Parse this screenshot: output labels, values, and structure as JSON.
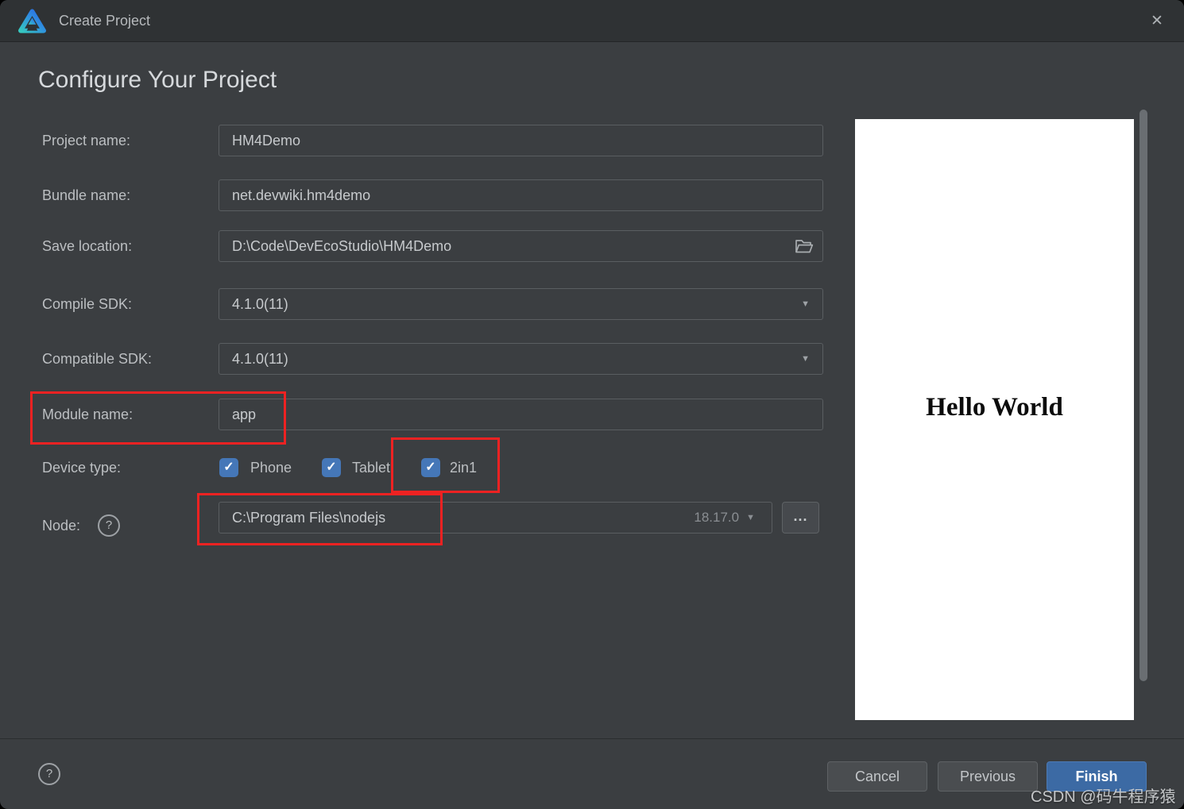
{
  "window": {
    "title": "Create Project",
    "close": "✕"
  },
  "heading": "Configure Your Project",
  "form": {
    "project_name": {
      "label": "Project name:",
      "value": "HM4Demo"
    },
    "bundle_name": {
      "label": "Bundle name:",
      "value": "net.devwiki.hm4demo"
    },
    "save_location": {
      "label": "Save location:",
      "value": "D:\\Code\\DevEcoStudio\\HM4Demo"
    },
    "compile_sdk": {
      "label": "Compile SDK:",
      "value": "4.1.0(11)"
    },
    "compatible_sdk": {
      "label": "Compatible SDK:",
      "value": "4.1.0(11)"
    },
    "module_name": {
      "label": "Module name:",
      "value": "app"
    },
    "device_type": {
      "label": "Device type:",
      "options": [
        {
          "label": "Phone",
          "checked": true
        },
        {
          "label": "Tablet",
          "checked": true
        },
        {
          "label": "2in1",
          "checked": true
        }
      ]
    },
    "node": {
      "label": "Node:",
      "path": "C:\\Program Files\\nodejs",
      "version": "18.17.0",
      "browse": "..."
    }
  },
  "preview": {
    "text": "Hello World"
  },
  "footer": {
    "cancel": "Cancel",
    "previous": "Previous",
    "finish": "Finish"
  },
  "watermark": "CSDN @码牛程序猿",
  "icons": {
    "check": "✓",
    "combo_arrow": "▼",
    "help": "?",
    "close": "✕"
  },
  "colors": {
    "checkbox_blue": "#4577b8",
    "finish_blue": "#3c6aa4",
    "highlight_red": "#ee2222"
  }
}
